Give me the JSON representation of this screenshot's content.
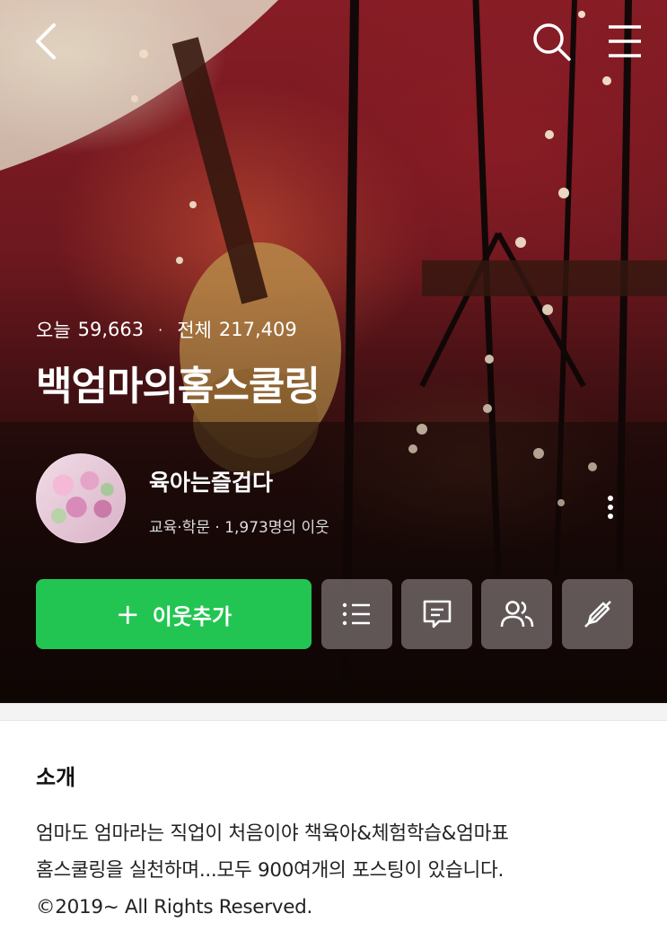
{
  "header": {
    "back_icon": "chevron-left-icon",
    "search_icon": "search-icon",
    "menu_icon": "hamburger-menu-icon"
  },
  "stats": {
    "today_label": "오늘",
    "today_value": "59,663",
    "separator": "·",
    "total_label": "전체",
    "total_value": "217,409"
  },
  "blog": {
    "title": "백엄마의홈스쿨링"
  },
  "profile": {
    "nickname": "육아는즐겁다",
    "category_line": "교육·학문 · 1,973명의 이웃"
  },
  "actions": {
    "add_neighbor_label": "이웃추가",
    "add_neighbor_icon": "plus-icon",
    "accent_color": "#22c552",
    "icon_buttons": [
      "list-icon",
      "chat-bubble-icon",
      "people-icon",
      "edit-slash-icon"
    ]
  },
  "intro": {
    "title": "소개",
    "body": "엄마도 엄마라는 직업이 처음이야 책육아&체험학습&엄마표\n홈스쿨링을 실천하며...모두 900여개의 포스팅이 있습니다.\n©2019~ All Rights Reserved."
  }
}
